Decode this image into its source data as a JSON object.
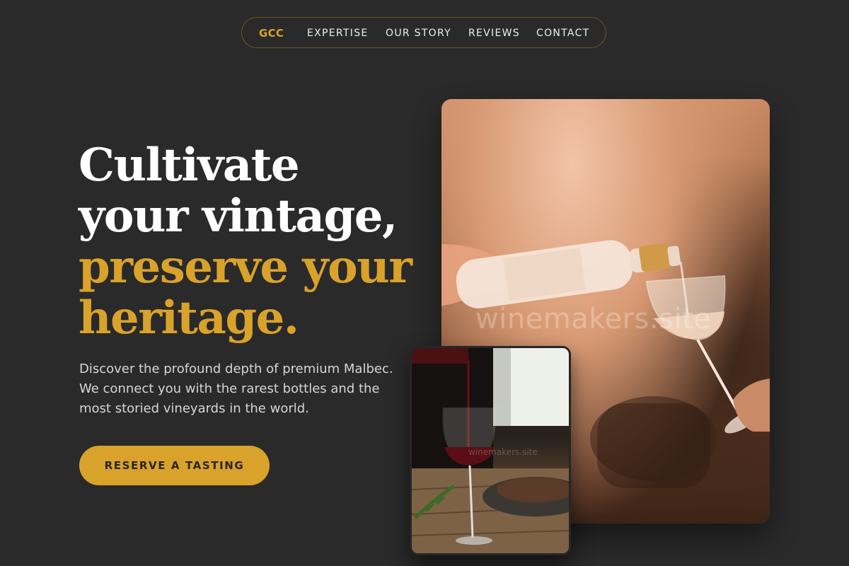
{
  "nav": {
    "logo": "GCC",
    "links": [
      "EXPERTISE",
      "OUR STORY",
      "REVIEWS",
      "CONTACT"
    ]
  },
  "hero": {
    "headline_line1": "Cultivate",
    "headline_line2": "your vintage,",
    "headline_line3": "preserve your",
    "headline_line4": "heritage.",
    "lede": "Discover the profound depth of premium Malbec. We connect you with the rarest bottles and the most storied vineyards in the world.",
    "cta_label": "RESERVE A TASTING"
  },
  "images": {
    "main_alt": "Rosé wine being poured from a bottle into a glass",
    "main_watermark": "winemakers.site",
    "secondary_alt": "Red wine being poured into a glass beside a plate of food",
    "secondary_watermark": "winemakers.site"
  },
  "colors": {
    "background": "#2a2a2a",
    "accent": "#d9a22a",
    "text": "#ffffff",
    "muted_text": "#d6d6d6"
  }
}
